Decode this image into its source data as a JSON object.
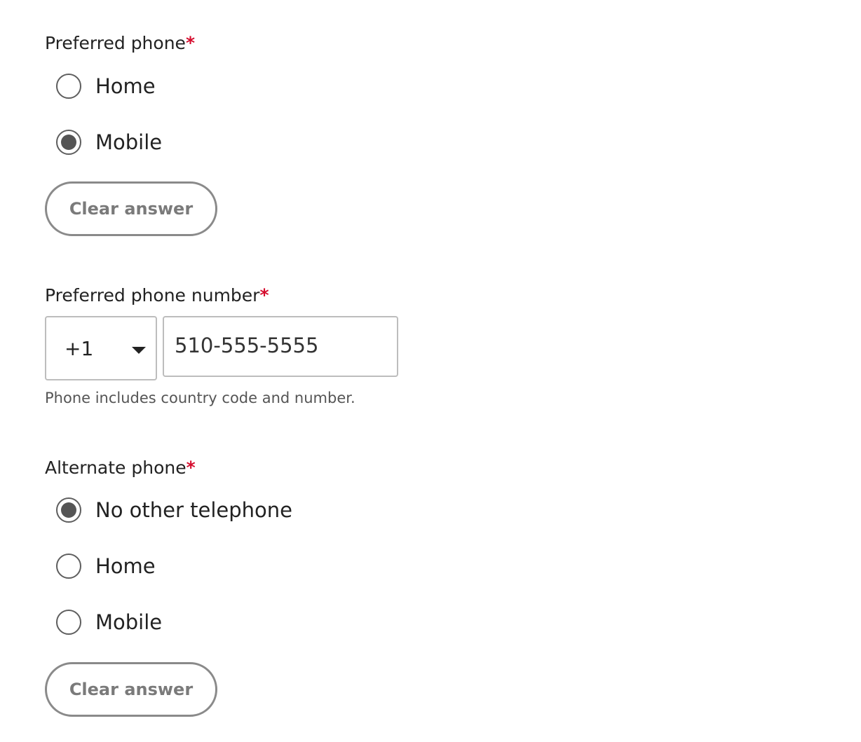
{
  "preferred_phone": {
    "label": "Preferred phone",
    "required_mark": "*",
    "options": [
      {
        "label": "Home",
        "checked": false
      },
      {
        "label": "Mobile",
        "checked": true
      }
    ],
    "clear_label": "Clear answer"
  },
  "preferred_phone_number": {
    "label": "Preferred phone number",
    "required_mark": "*",
    "country_code": "+1",
    "number_value": "510-555-5555",
    "hint": "Phone includes country code and number."
  },
  "alternate_phone": {
    "label": "Alternate phone",
    "required_mark": "*",
    "options": [
      {
        "label": "No other telephone",
        "checked": true
      },
      {
        "label": "Home",
        "checked": false
      },
      {
        "label": "Mobile",
        "checked": false
      }
    ],
    "clear_label": "Clear answer"
  },
  "colors": {
    "required": "#d50c2d",
    "radio_fill": "#555555",
    "button_border": "#8a8a8a"
  }
}
